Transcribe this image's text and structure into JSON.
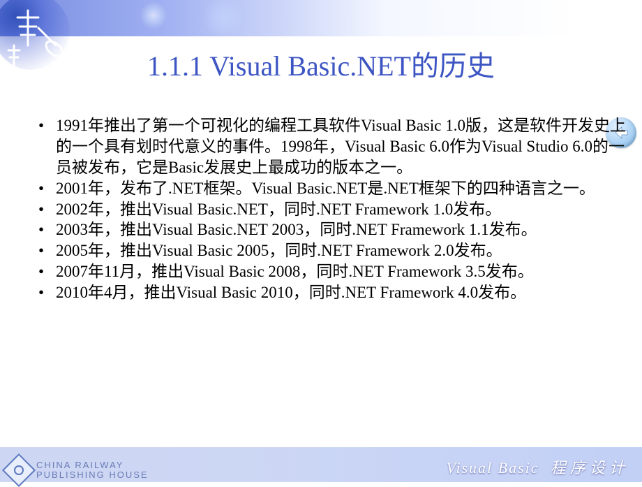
{
  "title": "1.1.1 Visual Basic.NET的历史",
  "bullets": [
    "1991年推出了第一个可视化的编程工具软件Visual Basic 1.0版，这是软件开发史上的一个具有划时代意义的事件。1998年，Visual Basic 6.0作为Visual Studio 6.0的一员被发布，它是Basic发展史上最成功的版本之一。",
    "2001年，发布了.NET框架。Visual Basic.NET是.NET框架下的四种语言之一。",
    "2002年，推出Visual Basic.NET，同时.NET Framework 1.0发布。",
    "2003年，推出Visual Basic.NET 2003，同时.NET Framework 1.1发布。",
    "2005年，推出Visual Basic 2005，同时.NET Framework 2.0发布。",
    "2007年11月，推出Visual Basic 2008，同时.NET Framework 3.5发布。",
    "2010年4月，推出Visual Basic 2010，同时.NET Framework 4.0发布。"
  ],
  "footer": {
    "brand_en": "Visual  Basic",
    "brand_cn": "程 序 设 计",
    "publisher_line1": "CHINA  RAILWAY",
    "publisher_line2": "PUBLISHING  HOUSE"
  }
}
